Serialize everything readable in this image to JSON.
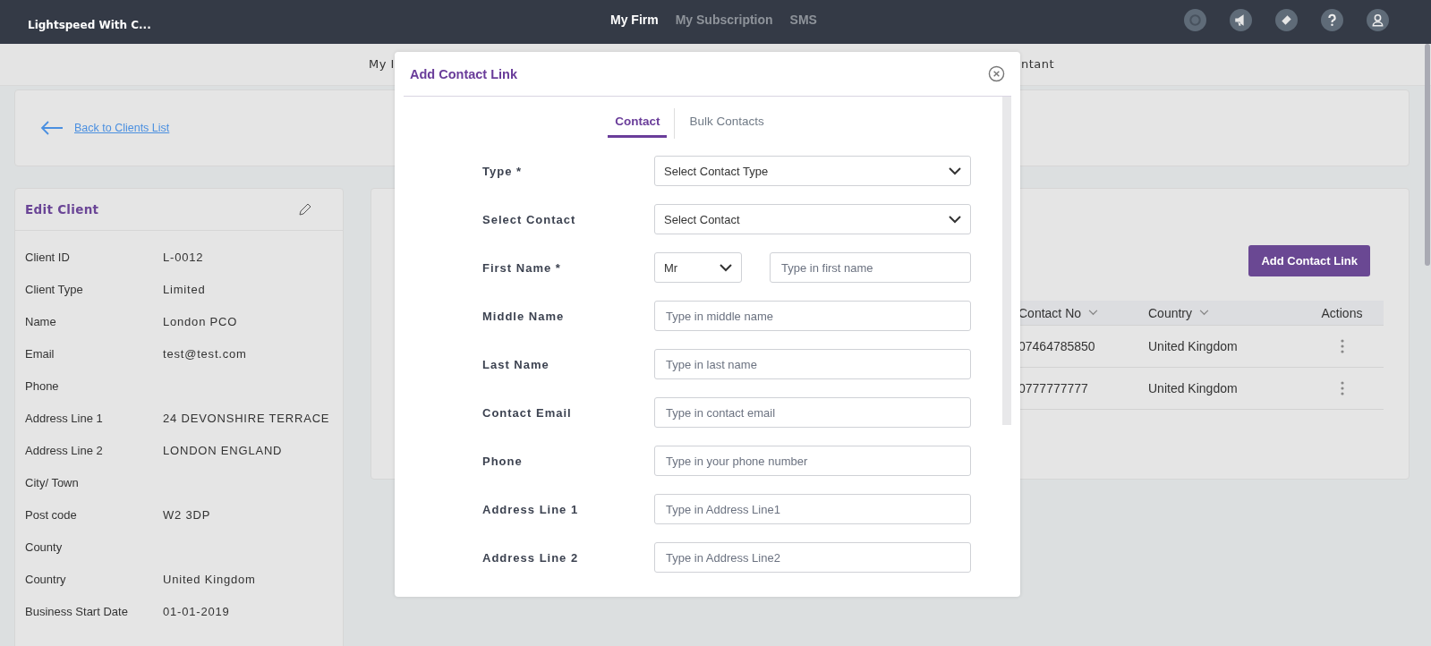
{
  "topbar": {
    "brand": "Lightspeed With C...",
    "nav": [
      {
        "label": "My Firm",
        "selected": true
      },
      {
        "label": "My Subscription",
        "selected": false
      },
      {
        "label": "SMS",
        "selected": false
      }
    ]
  },
  "subnav": {
    "left_fragment": "My I",
    "right_fragment": "ntant"
  },
  "back_link": "Back to Clients List",
  "edit_client": {
    "title": "Edit Client",
    "fields": [
      {
        "label": "Client ID",
        "value": "L-0012"
      },
      {
        "label": "Client Type",
        "value": "Limited"
      },
      {
        "label": "Name",
        "value": "London PCO"
      },
      {
        "label": "Email",
        "value": "test@test.com"
      },
      {
        "label": "Phone"
      },
      {
        "label": "Address Line 1",
        "value": "24 DEVONSHIRE TERRACE"
      },
      {
        "label": "Address Line 2",
        "value": "LONDON ENGLAND"
      },
      {
        "label": "City/ Town"
      },
      {
        "label": "Post code",
        "value": "W2 3DP"
      },
      {
        "label": "County"
      },
      {
        "label": "Country",
        "value": "United Kingdom"
      },
      {
        "label": "Business Start Date",
        "value": "01-01-2019"
      }
    ]
  },
  "contacts": {
    "add_button": "Add Contact Link",
    "columns": [
      "Contact No",
      "Country",
      "Actions"
    ],
    "rows": [
      {
        "contact_no": "07464785850",
        "country": "United Kingdom"
      },
      {
        "contact_no": "0777777777",
        "country": "United Kingdom"
      }
    ]
  },
  "modal": {
    "title": "Add Contact Link",
    "tabs": [
      {
        "label": "Contact",
        "selected": true
      },
      {
        "label": "Bulk Contacts",
        "selected": false
      }
    ],
    "fields": [
      {
        "kind": "select",
        "label": "Type *",
        "value": "Select Contact Type"
      },
      {
        "kind": "select",
        "label": "Select Contact",
        "value": "Select Contact"
      },
      {
        "kind": "name",
        "label": "First Name *",
        "title_value": "Mr",
        "placeholder": "Type in first name"
      },
      {
        "kind": "input",
        "label": "Middle Name",
        "placeholder": "Type in middle name"
      },
      {
        "kind": "input",
        "label": "Last Name",
        "placeholder": "Type in last name"
      },
      {
        "kind": "input",
        "label": "Contact Email",
        "placeholder": "Type in contact email"
      },
      {
        "kind": "input",
        "label": "Phone",
        "placeholder": "Type in your phone number"
      },
      {
        "kind": "input",
        "label": "Address Line 1",
        "placeholder": "Type in Address Line1"
      },
      {
        "kind": "input",
        "label": "Address Line 2",
        "placeholder": "Type in Address Line2"
      }
    ]
  }
}
